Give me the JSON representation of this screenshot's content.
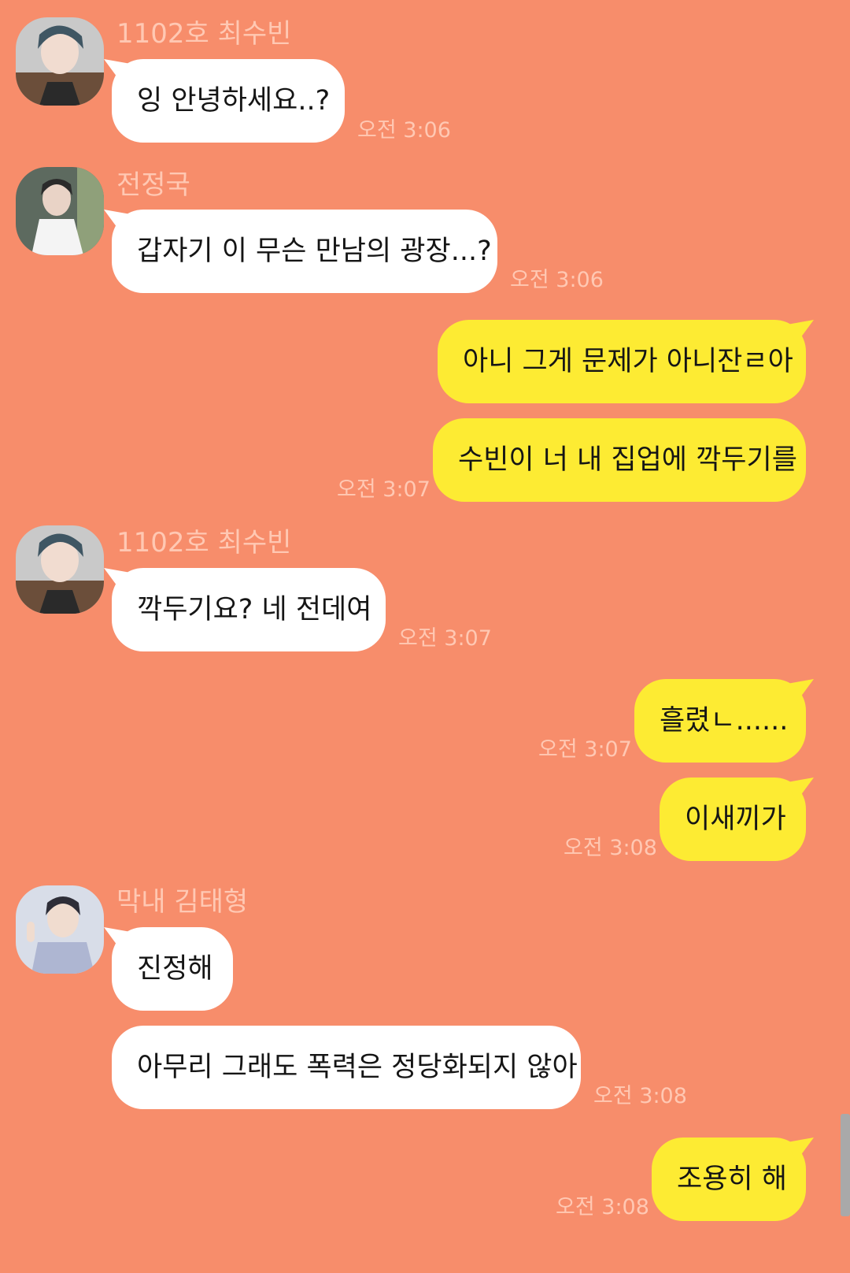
{
  "messages": [
    {
      "sender": "1102호 최수빈",
      "text": "잉 안녕하세요..?",
      "time": "오전 3:06"
    },
    {
      "sender": "전정국",
      "text": "갑자기 이 무슨 만남의 광장...?",
      "time": "오전 3:06"
    },
    {
      "text": "아니 그게 문제가 아니잔ㄹ아"
    },
    {
      "text": "수빈이 너 내 집업에 깍두기를",
      "time": "오전 3:07"
    },
    {
      "sender": "1102호 최수빈",
      "text": "깍두기요? 네 전데여",
      "time": "오전 3:07"
    },
    {
      "text": "흘렸ㄴ......",
      "time": "오전 3:07"
    },
    {
      "text": "이새끼가",
      "time": "오전 3:08"
    },
    {
      "sender": "막내 김태형",
      "text": "진정해"
    },
    {
      "text": "아무리 그래도 폭력은 정당화되지 않아",
      "time": "오전 3:08"
    },
    {
      "text": "조용히 해",
      "time": "오전 3:08"
    }
  ],
  "colors": {
    "background": "#f78d6b",
    "incoming_bubble": "#ffffff",
    "outgoing_bubble": "#fdeb33",
    "meta_text": "#ffc8b3"
  }
}
